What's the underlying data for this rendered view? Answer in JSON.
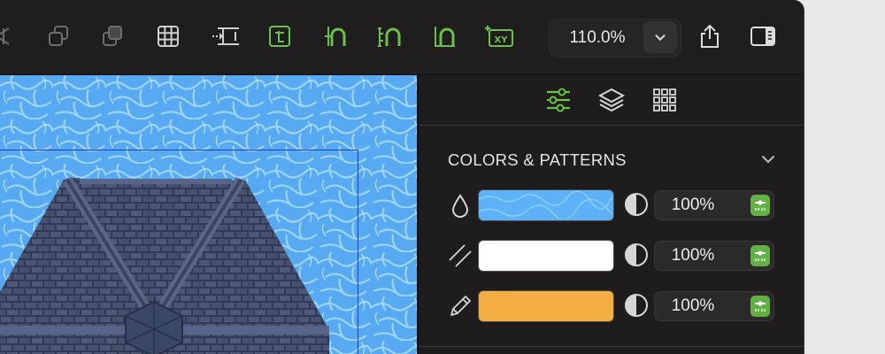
{
  "toolbar": {
    "tools": [
      {
        "name": "send-backward-icon",
        "color": "#6e6c6d"
      },
      {
        "name": "bring-forward-icon",
        "color": "#6e6c6d"
      },
      {
        "name": "send-to-back-icon",
        "color": "#6e6c6d"
      },
      {
        "name": "grid-icon",
        "color": "#cfcfcf"
      },
      {
        "name": "distribute-horizontal-icon",
        "color": "#cfcfcf"
      },
      {
        "name": "snap-to-object-icon",
        "color": "#6cc04a"
      },
      {
        "name": "align-path-icon",
        "color": "#6cc04a"
      },
      {
        "name": "snap-distance-icon",
        "color": "#6cc04a"
      },
      {
        "name": "snap-angle-icon",
        "color": "#6cc04a"
      },
      {
        "name": "xy-coordinates-icon",
        "color": "#6cc04a"
      }
    ],
    "xy_label": "XY",
    "zoom_value": "110.0%",
    "share_icon": "share-icon",
    "sidebar_icon": "sidebar-toggle-icon"
  },
  "panel": {
    "tabs": [
      {
        "name": "tab-style-settings",
        "icon": "sliders-icon",
        "active": true
      },
      {
        "name": "tab-layers",
        "icon": "layers-icon",
        "active": false
      },
      {
        "name": "tab-library",
        "icon": "grid-library-icon",
        "active": false
      }
    ],
    "section_title": "COLORS & PATTERNS",
    "rows": [
      {
        "label_icon": "fill-drop-icon",
        "swatch": "water-pattern",
        "opacity": "100%"
      },
      {
        "label_icon": "hatch-lines-icon",
        "swatch": "#ffffff",
        "opacity": "100%"
      },
      {
        "label_icon": "pencil-icon",
        "swatch": "#f3ad41",
        "opacity": "100%"
      }
    ]
  },
  "colors": {
    "accent_green": "#6cc04a",
    "water_blue": "#5db1f6",
    "roof_slate": "#3a4866",
    "pencil_orange": "#f3ad41"
  }
}
